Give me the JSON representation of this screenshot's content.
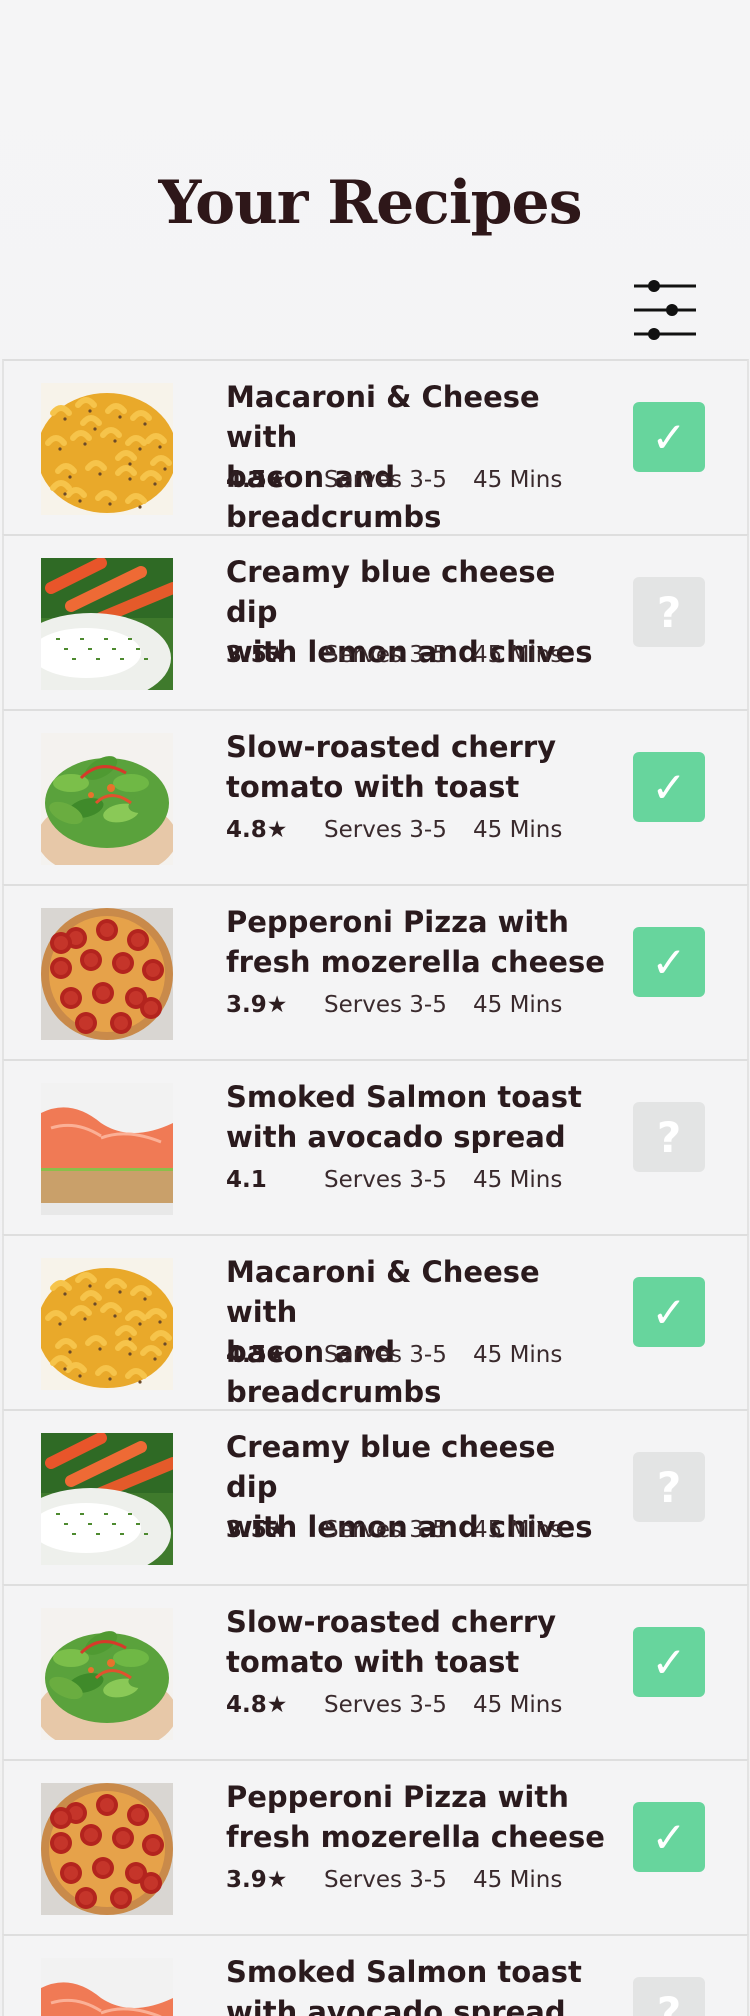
{
  "header": {
    "title": "Your Recipes",
    "filter_icon": "sliders-icon"
  },
  "colors": {
    "done_green": "#67d59d",
    "todo_gray": "#e3e4e4",
    "title_color": "#2e1719"
  },
  "recipes": [
    {
      "name": "Macaroni & Cheese with\nbacon and breadcrumbs",
      "rating": "4.5★",
      "serves": "Serves 3-5",
      "time": "45 Mins",
      "status": "done",
      "status_glyph": "✓",
      "image": "mac-and-cheese"
    },
    {
      "name": "Creamy blue cheese dip\nwith lemon and chives",
      "rating": "3.5★",
      "serves": "Serves 3-5",
      "time": "45 Mins",
      "status": "todo",
      "status_glyph": "?",
      "image": "blue-cheese-dip"
    },
    {
      "name": "Slow-roasted cherry\ntomato with toast",
      "rating": "4.8★",
      "serves": "Serves 3-5",
      "time": "45 Mins",
      "status": "done",
      "status_glyph": "✓",
      "image": "salad"
    },
    {
      "name": "Pepperoni Pizza with\nfresh mozerella cheese",
      "rating": "3.9★",
      "serves": "Serves 3-5",
      "time": "45 Mins",
      "status": "done",
      "status_glyph": "✓",
      "image": "pepperoni-pizza"
    },
    {
      "name": "Smoked Salmon toast\nwith avocado spread",
      "rating": "4.1",
      "serves": "Serves 3-5",
      "time": "45 Mins",
      "status": "todo",
      "status_glyph": "?",
      "image": "salmon-toast"
    },
    {
      "name": "Macaroni & Cheese with\nbacon and breadcrumbs",
      "rating": "4.5★",
      "serves": "Serves 3-5",
      "time": "45 Mins",
      "status": "done",
      "status_glyph": "✓",
      "image": "mac-and-cheese"
    },
    {
      "name": "Creamy blue cheese dip\nwith lemon and chives",
      "rating": "3.5★",
      "serves": "Serves 3-5",
      "time": "45 Mins",
      "status": "todo",
      "status_glyph": "?",
      "image": "blue-cheese-dip"
    },
    {
      "name": "Slow-roasted cherry\ntomato with toast",
      "rating": "4.8★",
      "serves": "Serves 3-5",
      "time": "45 Mins",
      "status": "done",
      "status_glyph": "✓",
      "image": "salad"
    },
    {
      "name": "Pepperoni Pizza with\nfresh mozerella cheese",
      "rating": "3.9★",
      "serves": "Serves 3-5",
      "time": "45 Mins",
      "status": "done",
      "status_glyph": "✓",
      "image": "pepperoni-pizza"
    },
    {
      "name": "Smoked Salmon toast\nwith avocado spread",
      "rating": "",
      "serves": "",
      "time": "",
      "status": "todo",
      "status_glyph": "?",
      "image": "salmon-toast"
    }
  ]
}
